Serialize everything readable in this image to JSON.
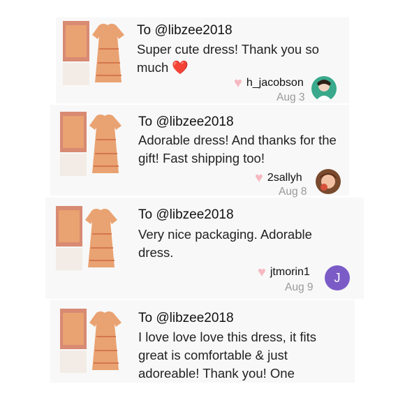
{
  "reviews": [
    {
      "to": "To @libzee2018",
      "message": "Super cute dress! Thank you so much",
      "emoji": "❤️",
      "username": "h_jacobson",
      "date": "Aug 3"
    },
    {
      "to": "To @libzee2018",
      "message": "Adorable dress! And thanks for the gift! Fast shipping too!",
      "username": "2sallyh",
      "date": "Aug 8"
    },
    {
      "to": "To @libzee2018",
      "message": "Very nice packaging. Adorable dress.",
      "username": "jtmorin1",
      "avatar_letter": "J",
      "date": "Aug 9"
    },
    {
      "to": "To @libzee2018",
      "message": "I love love love this dress, it fits great is comfortable & just adoreable! Thank you! One"
    }
  ],
  "icons": {
    "like": "heart-icon"
  },
  "colors": {
    "card_bg": "#f8f8f8",
    "like_heart": "#f6b8c0",
    "avatar_purple": "#7b5cc7",
    "dress_orange": "#e9a271"
  }
}
